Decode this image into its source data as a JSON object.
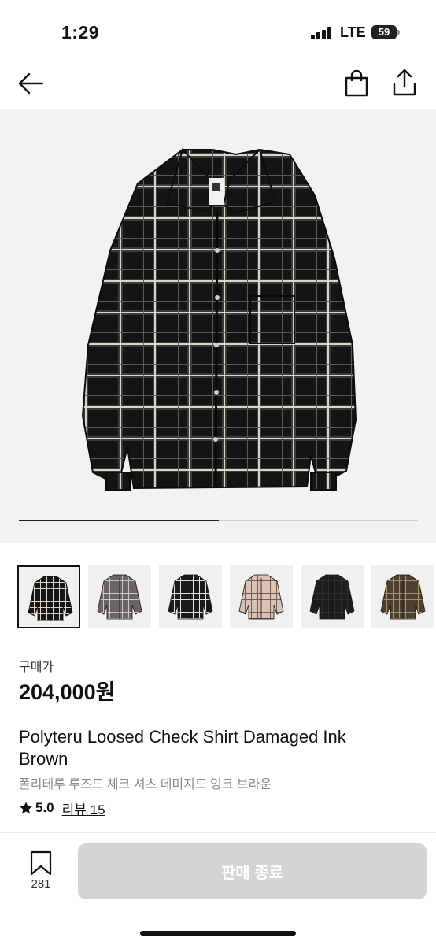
{
  "status_bar": {
    "time": "1:29",
    "network": "LTE",
    "battery": "59"
  },
  "nav": {
    "back_icon": "arrow-left-icon",
    "bag_icon": "shopping-bag-icon",
    "share_icon": "share-icon"
  },
  "gallery": {
    "progress_fraction": 0.5,
    "thumbnails": [
      {
        "name": "black-check-shirt",
        "selected": true
      },
      {
        "name": "grey-check-shirt",
        "selected": false
      },
      {
        "name": "black-white-check-shirt",
        "selected": false
      },
      {
        "name": "pink-beige-check-shirt",
        "selected": false
      },
      {
        "name": "solid-black-shirt",
        "selected": false
      },
      {
        "name": "brown-check-shirt",
        "selected": false
      }
    ]
  },
  "product": {
    "price_label": "구매가",
    "price": "204,000원",
    "title": "Polyteru Loosed Check Shirt Damaged Ink Brown",
    "subtitle": "폴리테루 루즈드 체크 셔츠 데미지드 잉크 브라운",
    "rating": "5.0",
    "review_label": "리뷰 15"
  },
  "bottom_bar": {
    "bookmark_count": "281",
    "action_label": "판매 종료",
    "action_color": "#d4d4d4"
  }
}
